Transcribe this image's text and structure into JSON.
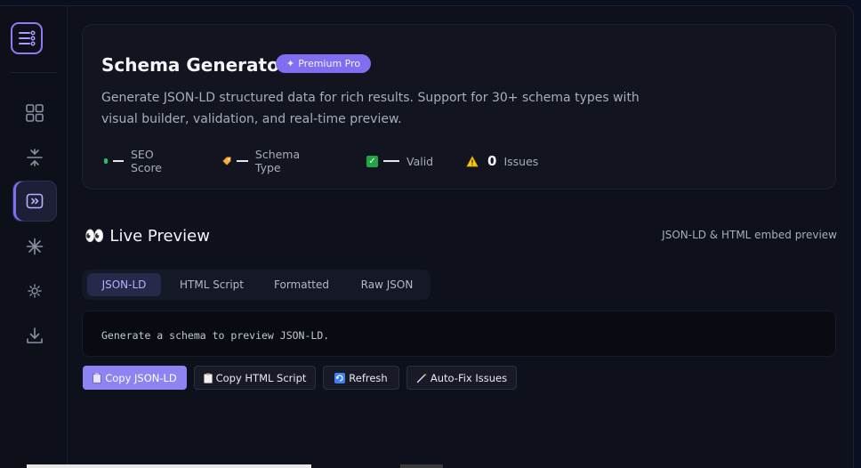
{
  "hero": {
    "title": "Schema Generator",
    "badge": "Premium Pro",
    "badge_glyph": "✦",
    "description": "Generate JSON-LD structured data for rich results. Support for 30+ schema types with visual builder, validation, and real-time preview.",
    "metrics": [
      {
        "label": "SEO Score"
      },
      {
        "label": "Schema Type"
      },
      {
        "label": "Valid"
      },
      {
        "value": "0",
        "label": "Issues"
      }
    ]
  },
  "preview_section": {
    "title": "Live Preview",
    "title_glyph": "👀",
    "subtitle": "JSON-LD & HTML embed preview",
    "tabs": [
      "JSON-LD",
      "HTML Script",
      "Formatted",
      "Raw JSON"
    ],
    "active_tab": "JSON-LD",
    "placeholder": "Generate a schema to preview JSON-LD."
  },
  "actions": {
    "copy_jsonld": "Copy JSON-LD",
    "copy_html": "Copy HTML Script",
    "refresh": "Refresh",
    "autofix": "Auto-Fix Issues"
  },
  "icons": {
    "logo": "menu-list-icon",
    "nav": [
      "grid-icon",
      "compress-icon",
      "code-icon",
      "sparkle-icon",
      "sun-icon",
      "download-icon"
    ]
  },
  "colors": {
    "accent": "#8f83f3",
    "badge": "#7f6ef0",
    "success": "#22c55e",
    "warning": "#facc15"
  }
}
